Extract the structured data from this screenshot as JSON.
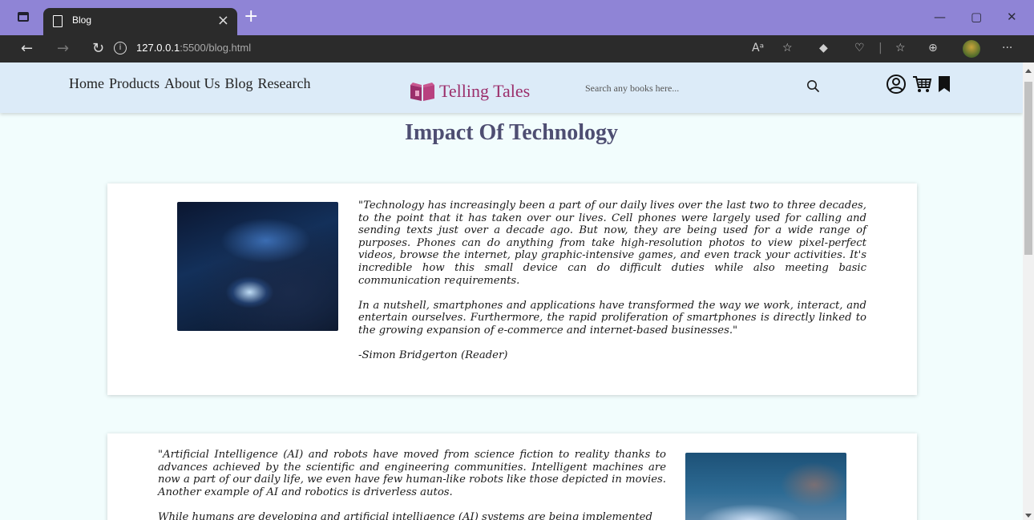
{
  "browser": {
    "tab_title": "Blog",
    "tab_close": "×",
    "new_tab": "+",
    "url_host": "127.0.0.1",
    "url_path": ":5500/blog.html",
    "info_symbol": "i",
    "read_aloud_glyph": "Aᵃ",
    "more_glyph": "···",
    "min_glyph": "—",
    "restore_glyph": "▢",
    "close_glyph": "✕"
  },
  "site": {
    "nav": [
      "Home",
      "Products",
      "About Us",
      "Blog",
      "Research"
    ],
    "logo_text": "Telling Tales",
    "search_placeholder": "Search any books here...",
    "brand_color": "#9b2e6b"
  },
  "main": {
    "title": "Impact Of Technology",
    "posts": [
      {
        "paragraphs": [
          "\"Technology has increasingly been a part of our daily lives over the last two to three decades, to the point that it has taken over our lives. Cell phones were largely used for calling and sending texts just over a decade ago. But now, they are being used for a wide range of purposes. Phones can do anything from take high-resolution photos to view pixel-perfect videos, browse the internet, play graphic-intensive games, and even track your activities. It's incredible how this small device can do difficult duties while also meeting basic communication requirements.",
          "In a nutshell, smartphones and applications have transformed the way we work, interact, and entertain ourselves. Furthermore, the rapid proliferation of smartphones is directly linked to the growing expansion of e-commerce and internet-based businesses.\"",
          "-Simon Bridgerton (Reader)"
        ]
      },
      {
        "paragraphs": [
          "\"Artificial Intelligence (AI) and robots have moved from science fiction to reality thanks to advances achieved by the scientific and engineering communities. Intelligent machines are now a part of our daily life, we even have few human-like robots like those depicted in movies. Another example of AI and robotics is driverless autos.",
          "While humans are developing and artificial intelligence (AI) systems are being implemented"
        ]
      }
    ]
  }
}
